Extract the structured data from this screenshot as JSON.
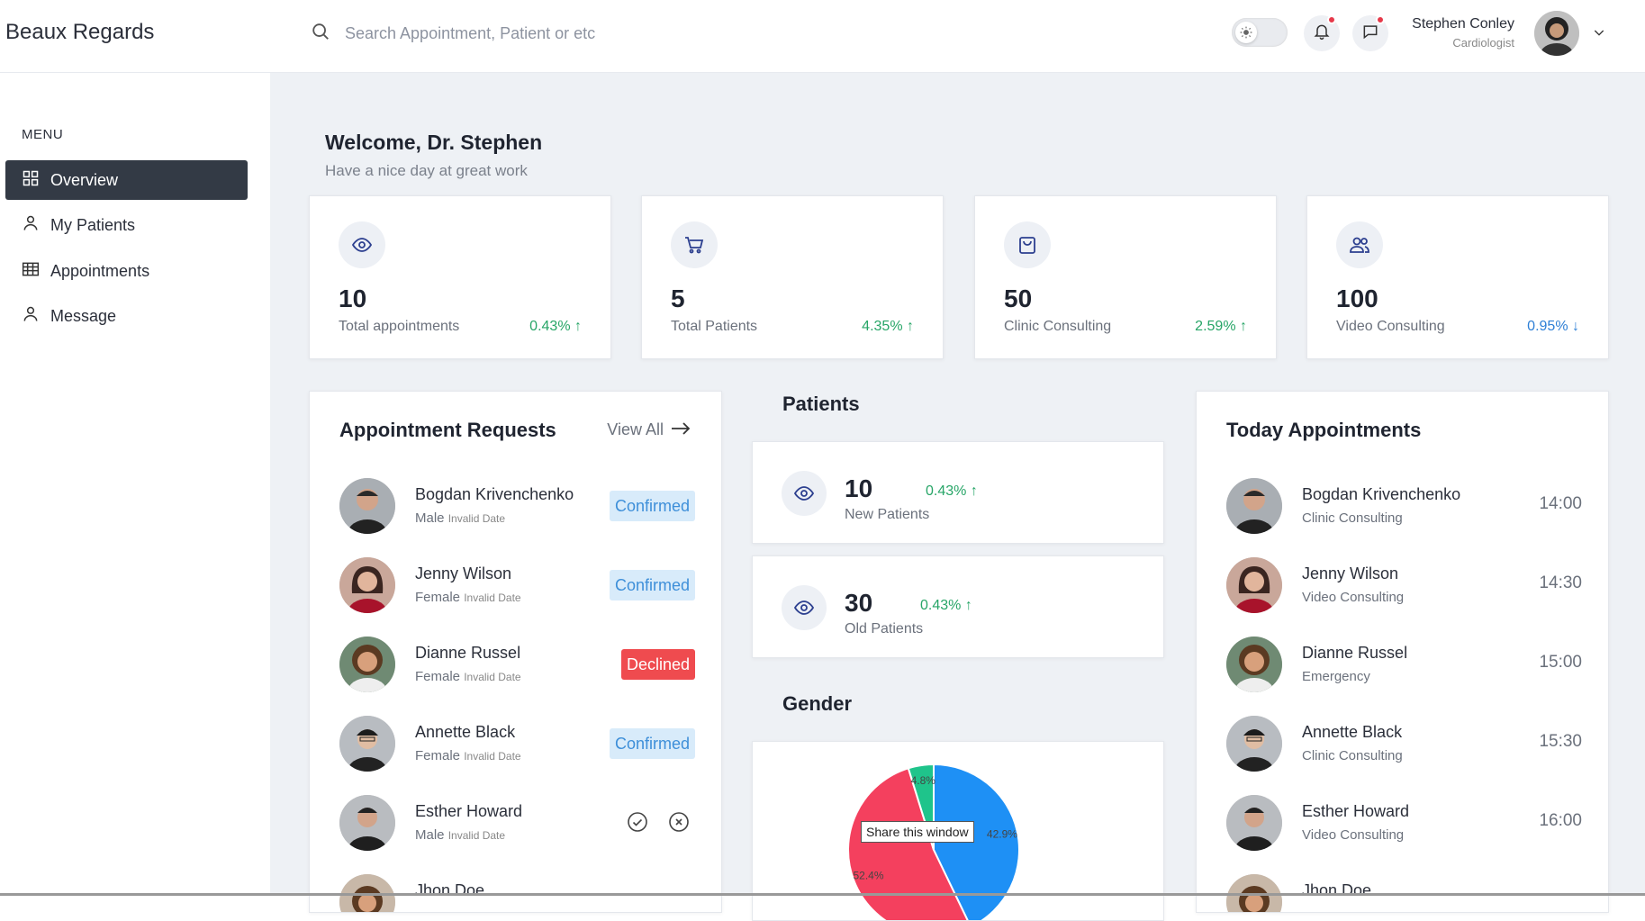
{
  "app": {
    "brand": "Beaux Regards"
  },
  "search": {
    "placeholder": "Search Appointment, Patient or etc"
  },
  "user": {
    "name": "Stephen Conley",
    "role": "Cardiologist"
  },
  "sidebar": {
    "menu_heading": "MENU",
    "items": [
      {
        "label": "Overview",
        "icon": "grid-icon",
        "active": true
      },
      {
        "label": "My Patients",
        "icon": "person-icon"
      },
      {
        "label": "Appointments",
        "icon": "calendar-table-icon"
      },
      {
        "label": "Message",
        "icon": "person-icon"
      }
    ]
  },
  "welcome": {
    "title": "Welcome, Dr. Stephen",
    "subtitle": "Have a nice day at great work"
  },
  "stats": [
    {
      "value": "10",
      "label": "Total appointments",
      "change": "0.43%",
      "direction": "up",
      "icon": "eye-icon"
    },
    {
      "value": "5",
      "label": "Total Patients",
      "change": "4.35%",
      "direction": "up",
      "icon": "cart-icon"
    },
    {
      "value": "50",
      "label": "Clinic Consulting",
      "change": "2.59%",
      "direction": "up",
      "icon": "bag-icon"
    },
    {
      "value": "100",
      "label": "Video Consulting",
      "change": "0.95%",
      "direction": "down",
      "icon": "users-icon"
    }
  ],
  "requests": {
    "title": "Appointment Requests",
    "view_all": "View All",
    "items": [
      {
        "name": "Bogdan Krivenchenko",
        "gender": "Male",
        "date": "Invalid Date",
        "status": "Confirmed"
      },
      {
        "name": "Jenny Wilson",
        "gender": "Female",
        "date": "Invalid Date",
        "status": "Confirmed"
      },
      {
        "name": "Dianne Russel",
        "gender": "Female",
        "date": "Invalid Date",
        "status": "Declined"
      },
      {
        "name": "Annette Black",
        "gender": "Female",
        "date": "Invalid Date",
        "status": "Confirmed"
      },
      {
        "name": "Esther Howard",
        "gender": "Male",
        "date": "Invalid Date",
        "status": "pending"
      },
      {
        "name": "Jhon Doe",
        "gender": "",
        "date": "",
        "status": ""
      }
    ]
  },
  "patients": {
    "title": "Patients",
    "cards": [
      {
        "value": "10",
        "change": "0.43%",
        "label": "New Patients"
      },
      {
        "value": "30",
        "change": "0.43%",
        "label": "Old Patients"
      }
    ]
  },
  "gender": {
    "title": "Gender",
    "tooltip": "Share this window"
  },
  "chart_data": {
    "type": "pie",
    "slices": [
      {
        "label": "42.9%",
        "value": 42.9,
        "color": "#1e90f5"
      },
      {
        "label": "52.4%",
        "value": 52.4,
        "color": "#f4405e"
      },
      {
        "label": "4.8%",
        "value": 4.8,
        "color": "#1fc48b"
      }
    ]
  },
  "today": {
    "title": "Today Appointments",
    "items": [
      {
        "name": "Bogdan Krivenchenko",
        "type": "Clinic Consulting",
        "time": "14:00"
      },
      {
        "name": "Jenny Wilson",
        "type": "Video Consulting",
        "time": "14:30"
      },
      {
        "name": "Dianne Russel",
        "type": "Emergency",
        "time": "15:00"
      },
      {
        "name": "Annette Black",
        "type": "Clinic Consulting",
        "time": "15:30"
      },
      {
        "name": "Esther Howard",
        "type": "Video Consulting",
        "time": "16:00"
      },
      {
        "name": "Jhon Doe",
        "type": "",
        "time": ""
      }
    ]
  }
}
